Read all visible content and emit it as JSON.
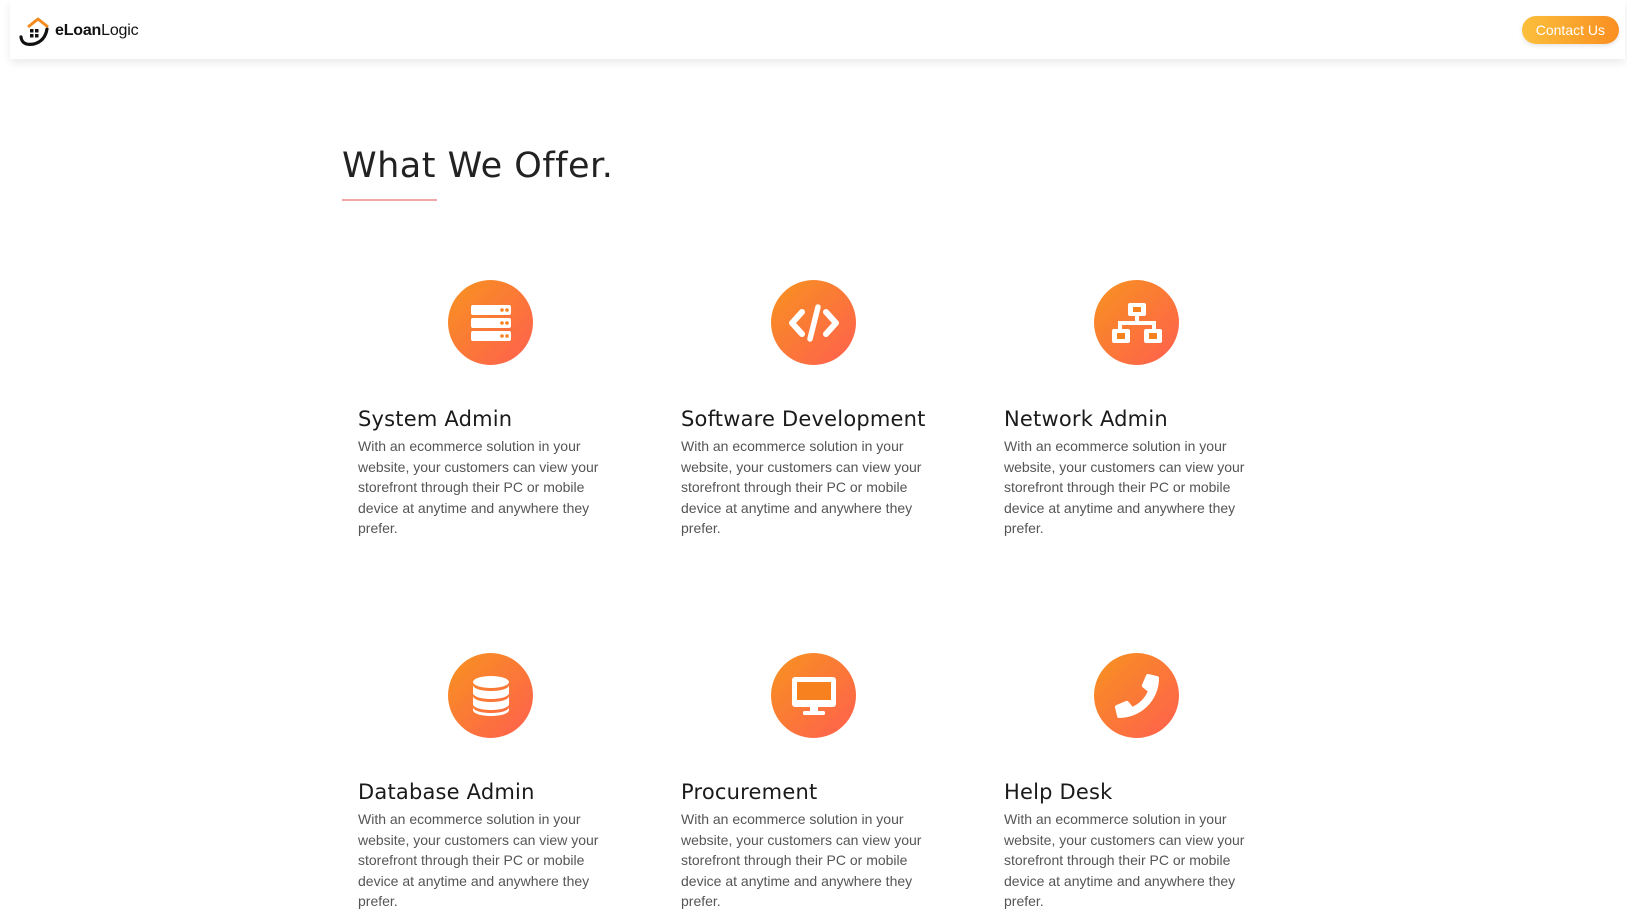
{
  "brand": {
    "logo_bold": "eLoan",
    "logo_light": "Logic"
  },
  "nav": {
    "contact_label": "Contact Us"
  },
  "section": {
    "title": "What We Offer."
  },
  "services": [
    {
      "title": "System Admin",
      "icon": "server-icon",
      "description": "With an ecommerce solution in your website, your customers can view your storefront through their PC or mobile device at anytime and anywhere they prefer."
    },
    {
      "title": "Software Development",
      "icon": "code-icon",
      "description": "With an ecommerce solution in your website, your customers can view your storefront through their PC or mobile device at anytime and anywhere they prefer."
    },
    {
      "title": "Network Admin",
      "icon": "network-icon",
      "description": "With an ecommerce solution in your website, your customers can view your storefront through their PC or mobile device at anytime and anywhere they prefer."
    },
    {
      "title": "Database Admin",
      "icon": "database-icon",
      "description": "With an ecommerce solution in your website, your customers can view your storefront through their PC or mobile device at anytime and anywhere they prefer."
    },
    {
      "title": "Procurement",
      "icon": "desktop-icon",
      "description": "With an ecommerce solution in your website, your customers can view your storefront through their PC or mobile device at anytime and anywhere they prefer."
    },
    {
      "title": "Help Desk",
      "icon": "phone-icon",
      "description": "With an ecommerce solution in your website, your customers can view your storefront through their PC or mobile device at anytime and anywhere they prefer."
    }
  ],
  "colors": {
    "accent_start": "#f7931f",
    "accent_end": "#ff5f4f",
    "button_start": "#fbbf3c",
    "button_end": "#fa8f21",
    "underline": "#f3a6a6"
  }
}
